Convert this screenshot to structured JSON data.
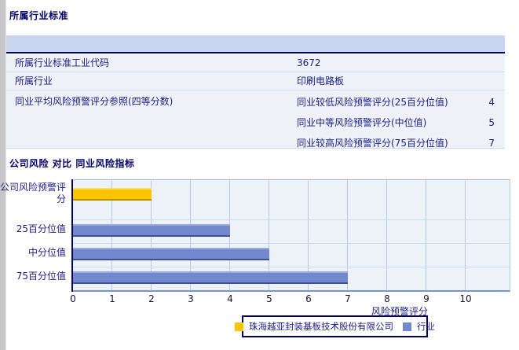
{
  "section1": {
    "title": "所属行业标准",
    "rows": [
      {
        "label": "所属行业标准工业代码",
        "value": "3672"
      },
      {
        "label": "所属行业",
        "value": "印刷电路板"
      }
    ],
    "group_row": {
      "label": "同业平均风险预警评分参照(四等分数)",
      "items": [
        {
          "label": "同业较低风险预警评分(25百分位值)",
          "value": "4"
        },
        {
          "label": "同业中等风险预警评分(中位值)",
          "value": "5"
        },
        {
          "label": "同业较高风险预警评分(75百分位值)",
          "value": "7"
        }
      ]
    }
  },
  "section2": {
    "title": "公司风险 对比 同业风险指标"
  },
  "chart_data": {
    "type": "bar",
    "orientation": "horizontal",
    "title": "公司风险 对比 同业风险指标",
    "categories": [
      "公司风险预警评分",
      "25百分位值",
      "中分位值",
      "75百分位值"
    ],
    "series": [
      {
        "name": "珠海越亚封装基板技术股份有限公司",
        "color": "company",
        "hex": "#FCC503",
        "values": [
          2,
          null,
          null,
          null
        ]
      },
      {
        "name": "行业",
        "color": "industry",
        "hex": "#7289CE",
        "values": [
          null,
          4,
          5,
          7
        ]
      }
    ],
    "xlabel": "风险预警评分",
    "xlim": [
      0,
      10
    ],
    "xticks": [
      0,
      1,
      2,
      3,
      4,
      5,
      6,
      7,
      8,
      9,
      10
    ],
    "grid": true,
    "legend_position": "bottom",
    "plot_bg": "#EDF1F8"
  },
  "colors": {
    "header_band": "#C7D6EE",
    "row_bg": "#EEF1F7",
    "navy_text": "#1C1C82",
    "title_text": "#00006B"
  }
}
